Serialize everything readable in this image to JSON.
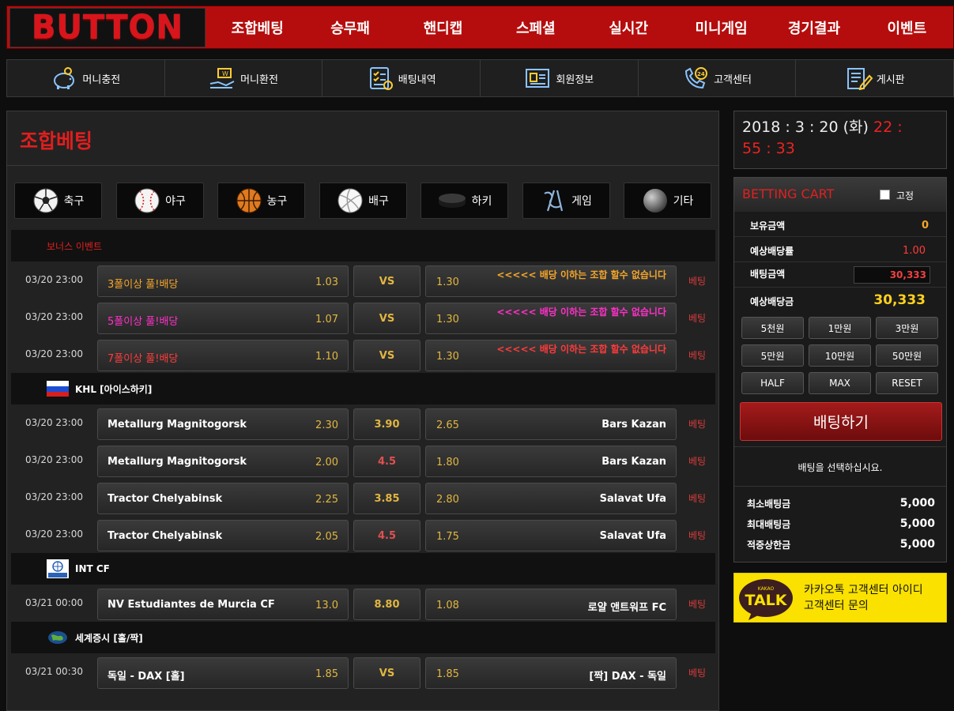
{
  "logo": "BUTTON",
  "top_nav": [
    "조합베팅",
    "승무패",
    "핸디캡",
    "스페셜",
    "실시간",
    "미니게임",
    "경기결과",
    "이벤트"
  ],
  "sub_nav": [
    {
      "label": "머니충전",
      "icon": "piggy-bank-icon"
    },
    {
      "label": "머니환전",
      "icon": "exchange-hand-icon"
    },
    {
      "label": "배팅내역",
      "icon": "checklist-icon"
    },
    {
      "label": "회원정보",
      "icon": "member-card-icon"
    },
    {
      "label": "고객센터",
      "icon": "phone-24-icon"
    },
    {
      "label": "게시판",
      "icon": "board-pencil-icon"
    }
  ],
  "page_title": "조합베팅",
  "sports": [
    {
      "label": "축구",
      "icon": "soccer-ball-icon"
    },
    {
      "label": "야구",
      "icon": "baseball-icon"
    },
    {
      "label": "농구",
      "icon": "basketball-icon"
    },
    {
      "label": "배구",
      "icon": "volleyball-icon"
    },
    {
      "label": "하키",
      "icon": "hockey-puck-icon"
    },
    {
      "label": "게임",
      "icon": "starcraft-icon"
    },
    {
      "label": "기타",
      "icon": "other-ball-icon"
    }
  ],
  "bet_label": "베팅",
  "leagues": [
    {
      "name": "보너스 이벤트",
      "flag": "",
      "matches": [
        {
          "date": "03/20 23:00",
          "home": "3폴이상 풀!배당",
          "home_odd": "1.03",
          "mid": "VS",
          "away_odd": "1.30",
          "away": "<<<<< 배당 이하는 조합 할수 없습니다",
          "style": "orange"
        },
        {
          "date": "03/20 23:00",
          "home": "5폴이상 풀!배당",
          "home_odd": "1.07",
          "mid": "VS",
          "away_odd": "1.30",
          "away": "<<<<< 배당 이하는 조합 할수 없습니다",
          "style": "magenta"
        },
        {
          "date": "03/20 23:00",
          "home": "7폴이상 풀!배당",
          "home_odd": "1.10",
          "mid": "VS",
          "away_odd": "1.30",
          "away": "<<<<< 배당 이하는 조합 할수 없습니다",
          "style": "red"
        }
      ]
    },
    {
      "name": "KHL [아이스하키]",
      "flag": "russia",
      "matches": [
        {
          "date": "03/20 23:00",
          "home": "Metallurg Magnitogorsk",
          "home_odd": "2.30",
          "mid": "3.90",
          "away_odd": "2.65",
          "away": "Bars Kazan",
          "style": ""
        },
        {
          "date": "03/20 23:00",
          "home": "Metallurg Magnitogorsk",
          "home_odd": "2.00",
          "mid": "4.5",
          "away_odd": "1.80",
          "away": "Bars Kazan",
          "style": "handicap"
        },
        {
          "date": "03/20 23:00",
          "home": "Tractor Chelyabinsk",
          "home_odd": "2.25",
          "mid": "3.85",
          "away_odd": "2.80",
          "away": "Salavat Ufa",
          "style": ""
        },
        {
          "date": "03/20 23:00",
          "home": "Tractor Chelyabinsk",
          "home_odd": "2.05",
          "mid": "4.5",
          "away_odd": "1.75",
          "away": "Salavat Ufa",
          "style": "handicap"
        }
      ]
    },
    {
      "name": "INT CF",
      "flag": "fifa",
      "matches": [
        {
          "date": "03/21 00:00",
          "home": "NV Estudiantes de Murcia CF",
          "home_odd": "13.0",
          "mid": "8.80",
          "away_odd": "1.08",
          "away": "로얄 앤트워프 FC",
          "style": ""
        }
      ]
    },
    {
      "name": "세계증시 [홀/짝]",
      "flag": "globe",
      "matches": [
        {
          "date": "03/21 00:30",
          "home": "독일 - DAX [홀]",
          "home_odd": "1.85",
          "mid": "VS",
          "away_odd": "1.85",
          "away": "[짝] DAX - 독일",
          "style": ""
        }
      ]
    }
  ],
  "clock": {
    "date": "2018 : 3 : 20 (화)",
    "time_h": "22 :",
    "time_ms": "55 : 33"
  },
  "cart": {
    "title": "BETTING CART",
    "fix_label": "고정",
    "rows": [
      {
        "label": "보유금액",
        "value": "0"
      },
      {
        "label": "예상배당률",
        "value": "1.00"
      },
      {
        "label": "배팅금액",
        "value": "30,333"
      },
      {
        "label": "예상배당금",
        "value": "30,333"
      }
    ],
    "amount_buttons": [
      "5천원",
      "1만원",
      "3만원",
      "5만원",
      "10만원",
      "50만원",
      "HALF",
      "MAX",
      "RESET"
    ],
    "place_bet": "배팅하기",
    "select_msg": "배팅을 선택하십시요.",
    "limits": [
      {
        "label": "최소배팅금",
        "value": "5,000"
      },
      {
        "label": "최대배팅금",
        "value": "5,000"
      },
      {
        "label": "적중상한금",
        "value": "5,000"
      }
    ]
  },
  "kakao": {
    "badge": "TALK",
    "badge_small": "KAKAO",
    "line1": "카카오톡 고객센터 아이디",
    "line2": "고객센터 문의"
  },
  "colors": {
    "brand_red": "#b50d0d",
    "accent_red": "#e01e1e",
    "odds_gold": "#e2b640",
    "kakao_yellow": "#fae100"
  }
}
